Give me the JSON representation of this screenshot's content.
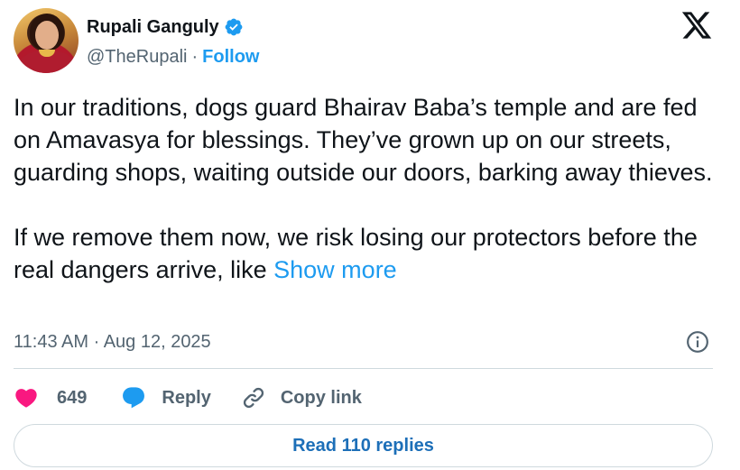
{
  "author": {
    "name": "Rupali Ganguly",
    "handle": "@TheRupali",
    "separator": "·",
    "follow_label": "Follow",
    "verified": true
  },
  "tweet": {
    "paragraphs": [
      "In our traditions, dogs guard Bhairav Baba’s temple and are fed on Amavasya for blessings. They’ve grown up on our streets, guarding shops, waiting outside our doors, barking away thieves.",
      "If we remove them now, we risk losing our protectors before the real dangers arrive, like "
    ],
    "show_more_label": "Show more",
    "timestamp": "11:43 AM · Aug 12, 2025"
  },
  "actions": {
    "like_count": "649",
    "reply_label": "Reply",
    "copy_link_label": "Copy link"
  },
  "read_replies_label": "Read 110 replies",
  "colors": {
    "accent": "#1d9bf0",
    "like": "#f91880",
    "secondary_text": "#536471",
    "divider": "#cfd9de"
  },
  "icons": [
    "verified-badge-icon",
    "x-logo-icon",
    "info-icon",
    "heart-icon",
    "reply-bubble-icon",
    "link-icon"
  ]
}
